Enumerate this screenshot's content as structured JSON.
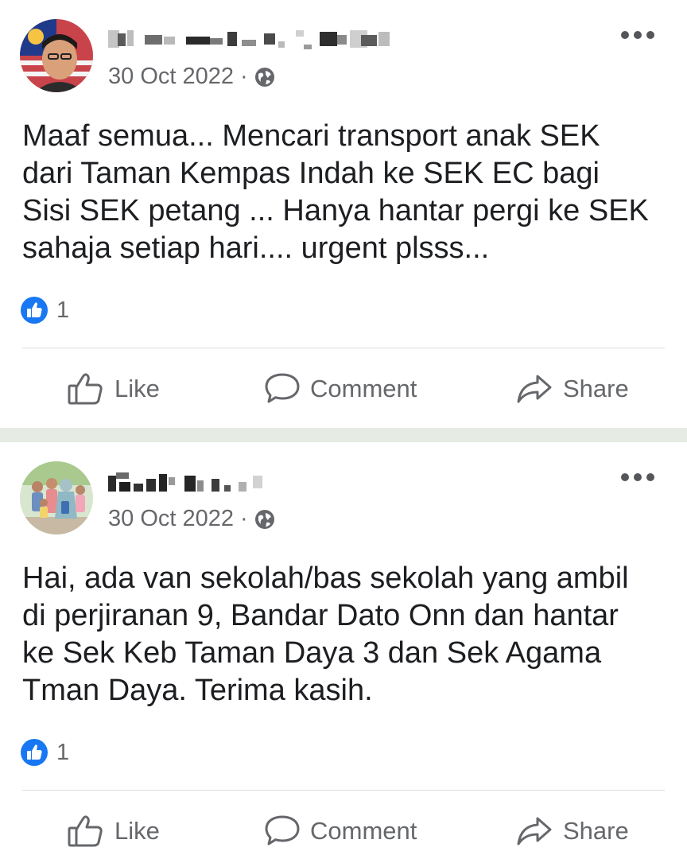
{
  "posts": [
    {
      "author_name": "",
      "timestamp": "30 Oct 2022",
      "separator": "·",
      "privacy_icon": "globe-icon",
      "text_lines": [
        "Maaf semua... Mencari transport anak SEK",
        "dari Taman Kempas Indah ke SEK EC bagi",
        "Sisi SEK petang ... Hanya hantar pergi ke SEK",
        "sahaja setiap hari.... urgent plsss..."
      ],
      "reaction_count": "1",
      "actions": {
        "like": "Like",
        "comment": "Comment",
        "share": "Share"
      }
    },
    {
      "author_name": "",
      "timestamp": "30 Oct 2022",
      "separator": "·",
      "privacy_icon": "globe-icon",
      "text_lines": [
        "Hai, ada van sekolah/bas sekolah yang ambil",
        "di perjiranan 9, Bandar Dato Onn dan hantar",
        "ke Sek Keb Taman Daya 3 dan Sek Agama",
        "Tman Daya. Terima kasih."
      ],
      "reaction_count": "1",
      "actions": {
        "like": "Like",
        "comment": "Comment",
        "share": "Share"
      }
    }
  ],
  "colors": {
    "primary_text": "#1c1e21",
    "secondary_text": "#65676b",
    "like_blue": "#1877f2",
    "separator_bg": "#e6ebe4",
    "divider": "#dadde1"
  }
}
